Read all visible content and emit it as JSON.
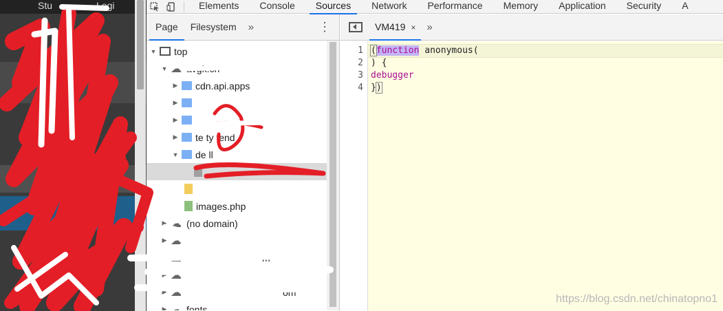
{
  "page_strip": {
    "partial_text": "Stu",
    "partial_text_2": "Logi"
  },
  "toolbar": {
    "inspect_icon": "inspect-element-icon",
    "device_icon": "device-toolbar-icon",
    "tabs": [
      "Elements",
      "Console",
      "Sources",
      "Network",
      "Performance",
      "Memory",
      "Application",
      "Security",
      "A"
    ],
    "active_tab": "Sources"
  },
  "navigator": {
    "tabs": [
      "Page",
      "Filesystem"
    ],
    "active_tab": "Page",
    "more_label": "»",
    "menu_label": "⋮",
    "tree": [
      {
        "label": "top",
        "arrow": "▼",
        "icon": "frame-icon"
      },
      {
        "label": "avgk.cn",
        "arrow": "▼",
        "icon": "cloud-icon"
      },
      {
        "label": "cdn.api.apps",
        "arrow": "▶",
        "icon": "folder-icon"
      },
      {
        "label": "",
        "arrow": "▶",
        "icon": "folder-icon"
      },
      {
        "label": "",
        "arrow": "▶",
        "icon": "folder-icon"
      },
      {
        "label": "te    ty     tend",
        "arrow": "▶",
        "icon": "folder-icon"
      },
      {
        "label": "  de       ll",
        "arrow": "▼",
        "icon": "folder-icon"
      },
      {
        "label": "",
        "arrow": "",
        "icon": "file-icon"
      },
      {
        "label": "",
        "arrow": "",
        "icon": "js-file-icon"
      },
      {
        "label": "images.php",
        "arrow": "",
        "icon": "php-file-icon"
      },
      {
        "label": "(no domain)",
        "arrow": "▶",
        "icon": "cloud-icon"
      },
      {
        "label": "",
        "arrow": "▶",
        "icon": "cloud-icon"
      },
      {
        "label": "m",
        "arrow": "▶",
        "icon": "cloud-icon"
      },
      {
        "label": "",
        "arrow": "▶",
        "icon": "cloud-icon"
      },
      {
        "label": "om",
        "arrow": "▶",
        "icon": "cloud-icon"
      },
      {
        "label": "fonts",
        "arrow": "▶",
        "icon": "cloud-icon"
      }
    ]
  },
  "editor": {
    "tab_label": "VM419",
    "close_label": "×",
    "more_label": "»",
    "line_numbers": [
      "1",
      "2",
      "3",
      "4"
    ],
    "lines": {
      "l1_open": "(",
      "l1_keyword": "function",
      "l1_rest": " anonymous(",
      "l2": ") {",
      "l3": "debugger",
      "l4_close": "}",
      "l4_paren": ")"
    },
    "watermark": "https://blog.csdn.net/chinatopno1"
  },
  "colors": {
    "accent": "#1a73e8",
    "editor_bg": "#fffee3",
    "keyword": "#aa0d91",
    "scribble_red": "#e41e26",
    "scribble_white": "#ffffff"
  }
}
